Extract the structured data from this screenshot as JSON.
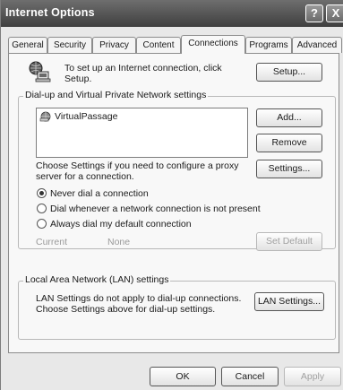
{
  "window": {
    "title": "Internet Options"
  },
  "titlebar": {
    "help_label": "?",
    "close_label": "X"
  },
  "tabs": [
    {
      "label": "General"
    },
    {
      "label": "Security"
    },
    {
      "label": "Privacy"
    },
    {
      "label": "Content"
    },
    {
      "label": "Connections",
      "active": true
    },
    {
      "label": "Programs"
    },
    {
      "label": "Advanced"
    }
  ],
  "setup": {
    "text_line1": "To set up an Internet connection, click",
    "text_line2": "Setup.",
    "button": "Setup..."
  },
  "dialup": {
    "legend": "Dial-up and Virtual Private Network settings",
    "connections": [
      "VirtualPassage"
    ],
    "add_button": "Add...",
    "remove_button": "Remove",
    "proxy_text_line1": "Choose Settings if you need to configure a proxy",
    "proxy_text_line2": "server for a connection.",
    "settings_button": "Settings...",
    "options": [
      {
        "label": "Never dial a connection",
        "selected": true
      },
      {
        "label": "Dial whenever a network connection is not present",
        "selected": false
      },
      {
        "label": "Always dial my default connection",
        "selected": false
      }
    ],
    "current_label": "Current",
    "current_value": "None",
    "set_default_button": "Set Default"
  },
  "lan": {
    "legend": "Local Area Network (LAN) settings",
    "text_line1": "LAN Settings do not apply to dial-up connections.",
    "text_line2": "Choose Settings above for dial-up settings.",
    "button": "LAN Settings..."
  },
  "footer": {
    "ok": "OK",
    "cancel": "Cancel",
    "apply": "Apply"
  }
}
